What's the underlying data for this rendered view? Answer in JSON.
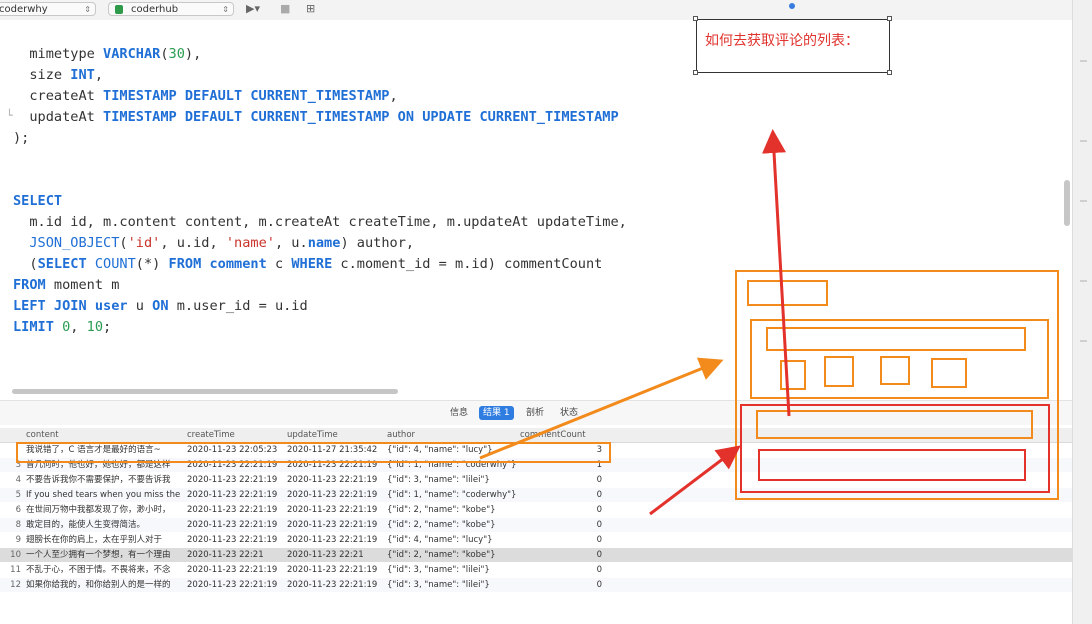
{
  "toolbar": {
    "connection": "coderwhy",
    "database": "coderhub",
    "run_icon": "play-icon",
    "stop_icon": "stop-icon",
    "explain_icon": "explain-icon"
  },
  "editor": {
    "code_lines": [
      [
        {
          "t": "  mimetype "
        },
        {
          "t": "VARCHAR",
          "c": "kw"
        },
        {
          "t": "("
        },
        {
          "t": "30",
          "c": "num"
        },
        {
          "t": "),"
        }
      ],
      [
        {
          "t": "  size "
        },
        {
          "t": "INT",
          "c": "kw"
        },
        {
          "t": ","
        }
      ],
      [
        {
          "t": "  createAt "
        },
        {
          "t": "TIMESTAMP DEFAULT CURRENT_TIMESTAMP",
          "c": "kw"
        },
        {
          "t": ","
        }
      ],
      [
        {
          "t": "  updateAt "
        },
        {
          "t": "TIMESTAMP DEFAULT CURRENT_TIMESTAMP ON UPDATE CURRENT_TIMESTAMP",
          "c": "kw"
        }
      ],
      [
        {
          "t": ");"
        }
      ],
      [
        {
          "t": ""
        }
      ],
      [
        {
          "t": ""
        }
      ],
      [
        {
          "t": "SELECT",
          "c": "kw"
        }
      ],
      [
        {
          "t": "  m.id id, m.content content, m.createAt createTime, m.updateAt updateTime,"
        }
      ],
      [
        {
          "t": "  "
        },
        {
          "t": "JSON_OBJECT",
          "c": "fn"
        },
        {
          "t": "("
        },
        {
          "t": "'id'",
          "c": "str"
        },
        {
          "t": ", u.id, "
        },
        {
          "t": "'name'",
          "c": "str"
        },
        {
          "t": ", u."
        },
        {
          "t": "name",
          "c": "kw"
        },
        {
          "t": ") author,"
        }
      ],
      [
        {
          "t": "  ("
        },
        {
          "t": "SELECT",
          "c": "kw"
        },
        {
          "t": " "
        },
        {
          "t": "COUNT",
          "c": "fn"
        },
        {
          "t": "(*) "
        },
        {
          "t": "FROM",
          "c": "kw"
        },
        {
          "t": " "
        },
        {
          "t": "comment",
          "c": "kw"
        },
        {
          "t": " c "
        },
        {
          "t": "WHERE",
          "c": "kw"
        },
        {
          "t": " c.moment_id = m.id) commentCount"
        }
      ],
      [
        {
          "t": "FROM",
          "c": "kw"
        },
        {
          "t": " moment m"
        }
      ],
      [
        {
          "t": "LEFT JOIN",
          "c": "kw"
        },
        {
          "t": " "
        },
        {
          "t": "user",
          "c": "kw"
        },
        {
          "t": " u "
        },
        {
          "t": "ON",
          "c": "kw"
        },
        {
          "t": " m.user_id = u.id"
        }
      ],
      [
        {
          "t": "LIMIT",
          "c": "kw"
        },
        {
          "t": " "
        },
        {
          "t": "0",
          "c": "num"
        },
        {
          "t": ", "
        },
        {
          "t": "10",
          "c": "num"
        },
        {
          "t": ";"
        }
      ]
    ]
  },
  "result_tabs": [
    {
      "label": "信息",
      "active": false
    },
    {
      "label": "结果 1",
      "active": true
    },
    {
      "label": "剖析",
      "active": false
    },
    {
      "label": "状态",
      "active": false
    }
  ],
  "grid": {
    "columns": [
      "content",
      "createTime",
      "updateTime",
      "author",
      "commentCount"
    ],
    "rows": [
      {
        "n": "",
        "content": "我说错了，C 语言才是最好的语言~",
        "createTime": "2020-11-23 22:05:23",
        "updateTime": "2020-11-27 21:35:42",
        "author": "{\"id\": 4, \"name\": \"lucy\"}",
        "commentCount": "3"
      },
      {
        "n": "3",
        "content": "曾几何时，他也好，她也好，都是这样",
        "createTime": "2020-11-23 22:21:19",
        "updateTime": "2020-11-23 22:21:19",
        "author": "{\"id\": 1, \"name\": \"coderwhy\"}",
        "commentCount": "1"
      },
      {
        "n": "4",
        "content": "不要告诉我你不需要保护，不要告诉我",
        "createTime": "2020-11-23 22:21:19",
        "updateTime": "2020-11-23 22:21:19",
        "author": "{\"id\": 3, \"name\": \"lilei\"}",
        "commentCount": "0"
      },
      {
        "n": "5",
        "content": "If you shed tears when you miss the",
        "createTime": "2020-11-23 22:21:19",
        "updateTime": "2020-11-23 22:21:19",
        "author": "{\"id\": 1, \"name\": \"coderwhy\"}",
        "commentCount": "0"
      },
      {
        "n": "6",
        "content": "在世间万物中我都发现了你，渺小时，",
        "createTime": "2020-11-23 22:21:19",
        "updateTime": "2020-11-23 22:21:19",
        "author": "{\"id\": 2, \"name\": \"kobe\"}",
        "commentCount": "0"
      },
      {
        "n": "8",
        "content": "敢定目的，能使人生变得简洁。",
        "createTime": "2020-11-23 22:21:19",
        "updateTime": "2020-11-23 22:21:19",
        "author": "{\"id\": 2, \"name\": \"kobe\"}",
        "commentCount": "0"
      },
      {
        "n": "9",
        "content": "翅膀长在你的肩上，太在乎别人对于",
        "createTime": "2020-11-23 22:21:19",
        "updateTime": "2020-11-23 22:21:19",
        "author": "{\"id\": 4, \"name\": \"lucy\"}",
        "commentCount": "0"
      },
      {
        "n": "10",
        "content": "一个人至少拥有一个梦想，有一个理由",
        "createTime": "2020-11-23 22:21",
        "updateTime": "2020-11-23 22:21",
        "author": "{\"id\": 2, \"name\": \"kobe\"}",
        "commentCount": "0"
      },
      {
        "n": "11",
        "content": "不乱于心，不困于情。不畏将来，不念",
        "createTime": "2020-11-23 22:21:19",
        "updateTime": "2020-11-23 22:21:19",
        "author": "{\"id\": 3, \"name\": \"lilei\"}",
        "commentCount": "0"
      },
      {
        "n": "12",
        "content": "如果你给我的，和你给别人的是一样的",
        "createTime": "2020-11-23 22:21:19",
        "updateTime": "2020-11-23 22:21:19",
        "author": "{\"id\": 3, \"name\": \"lilei\"}",
        "commentCount": "0"
      }
    ]
  },
  "annotation": {
    "note_text": "如何去获取评论的列表：",
    "colors": {
      "orange": "#f28a1c",
      "red": "#e3322b"
    }
  }
}
